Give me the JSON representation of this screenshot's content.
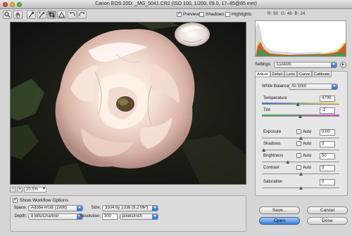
{
  "window": {
    "title": "Canon EOS 20D:  _MG_5041.CR2  (ISO 100, 1/200, f/9.0, 17–85@85 mm)"
  },
  "toolbar": {
    "tools": [
      "zoom-icon",
      "hand-icon",
      "white-balance-icon",
      "color-sampler-icon",
      "crop-icon",
      "straighten-icon",
      "rotate-left-icon",
      "rotate-right-icon"
    ],
    "preview_label": "Preview",
    "preview_checked": true,
    "shadows_label": "Shadows",
    "shadows_checked": false,
    "highlights_label": "Highlights",
    "highlights_checked": false
  },
  "readout": {
    "r_label": "R:",
    "r": "50",
    "g_label": "G:",
    "g": "48",
    "b_label": "B:",
    "b": "24"
  },
  "zoom": {
    "minus": "−",
    "plus": "+",
    "value": "20.5%"
  },
  "workflow": {
    "toggle_label": "Show Workflow Options",
    "toggle_checked": true,
    "space_label": "Space:",
    "space_value": "Adobe RGB (1998)",
    "depth_label": "Depth:",
    "depth_value": "8 Bits/Channel",
    "size_label": "Size:",
    "size_value": "3504 by 2336  (8.2 MP)",
    "resolution_label": "Resolution:",
    "resolution_value": "300",
    "resolution_unit": "pixels/inch"
  },
  "settings": {
    "label": "Settings:",
    "value": "Custom"
  },
  "tabs": [
    "Adjust",
    "Detail",
    "Lens",
    "Curve",
    "Calibrate"
  ],
  "adjust": {
    "wb_label": "White Balance:",
    "wb_value": "As Shot",
    "temperature_label": "Temperature",
    "temperature": "4700",
    "temperature_pos": 0.46,
    "tint_label": "Tint",
    "tint": "-2",
    "tint_pos": 0.49,
    "auto_label": "Auto",
    "exposure_label": "Exposure",
    "exposure": "0.00",
    "exposure_pos": 0.5,
    "shadows_label": "Shadows",
    "shadows": "0",
    "shadows_pos": 0.02,
    "brightness_label": "Brightness",
    "brightness": "50",
    "brightness_pos": 0.33,
    "contrast_label": "Contrast",
    "contrast": "0",
    "contrast_pos": 0.5,
    "saturation_label": "Saturation",
    "saturation": "0",
    "saturation_pos": 0.5
  },
  "buttons": {
    "save": "Save...",
    "cancel": "Cancel",
    "open": "Open",
    "done": "Done"
  }
}
